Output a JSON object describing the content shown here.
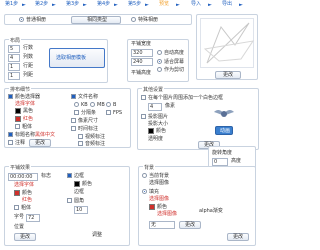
{
  "steps": {
    "items": [
      "第1步",
      "第2步",
      "第3步",
      "第4步",
      "第5步",
      "预览",
      "导入",
      "导出"
    ],
    "active_label": "预览",
    "colors": {
      "active": "#f2a02a",
      "inactive": "#1f5fbf",
      "box": "#4478c8"
    }
  },
  "mode_bar": {
    "option_normal": "普通相册",
    "option_group": "相同类型",
    "option_special": "特殊相册"
  },
  "layout": {
    "title": "布局",
    "rows_value": "5",
    "rows_label": "行数",
    "cols_value": "4",
    "cols_label": "列数",
    "spacing_value": "1",
    "spacing_label": "行距",
    "colspace_value": "1",
    "colspace_label": "列距",
    "preview_button": "选取相册模板"
  },
  "page_size": {
    "width_label": "平铺宽度",
    "width_value": "320",
    "height_label": "平铺高度",
    "height_value": "240",
    "auto_label": "自动高度",
    "fit_label": "适合屏幕",
    "stretch_label": "作为剪切"
  },
  "more_button": "更改",
  "thumb_detail": {
    "title": "排布细节",
    "line1": "颜色选择器",
    "line1_value": "选择字体",
    "color_black": "黑色",
    "color_red": "红色",
    "bold": "粗体",
    "italic": "斜体",
    "label_size": "字号大小",
    "name_text": "标题名称",
    "name_color": "黑体中文",
    "note": "注释",
    "change": "更改"
  },
  "file_attrs": {
    "title": "文件名称",
    "kb": "KB",
    "mb": "MB",
    "bits": "B",
    "sep": "分隔条",
    "fps": "FPS",
    "dimensions": "像素尺寸",
    "show_dates": "时间标注",
    "show_video": "视频标注",
    "show_audio": "音频标注"
  },
  "other_settings": {
    "title": "其他设置",
    "opt1": "在每个图片周围添加一个白色边框",
    "dims_label": "像素",
    "dims_value": "4",
    "shadow": "投影图片",
    "blur": "投影大小",
    "color": "颜色",
    "opacity": "透明度",
    "image_note": "动画",
    "change": "更改"
  },
  "rotate": {
    "title": "旋转",
    "angle_label": "旋转角度",
    "angle_value": "0",
    "height_label": "高度",
    "height_value": "1"
  },
  "fill_effect": {
    "title": "平铺效果",
    "transition_label": "标志",
    "time_value": "00:00:00",
    "font_label": "选择字体",
    "color_label": "颜色",
    "color_value": "红色",
    "bold": "粗体",
    "size_label": "字号",
    "size_value": "72",
    "border_label": "边框",
    "border_color": "颜色",
    "border_value": "边框",
    "corner_label": "圆角",
    "corner_value": "10",
    "position_label": "位置",
    "position_value": "更改",
    "tab_label": "调整"
  },
  "background": {
    "title": "背景",
    "color_label": "当前背景",
    "choose": "选择图像",
    "fill": "填充",
    "fill_pick": "选择图像",
    "fill_color": "颜色",
    "fill_value": "选择图像",
    "gradient_label": "alpha渐变",
    "gradient_value": "无",
    "change": "更改",
    "preview": "更改"
  }
}
